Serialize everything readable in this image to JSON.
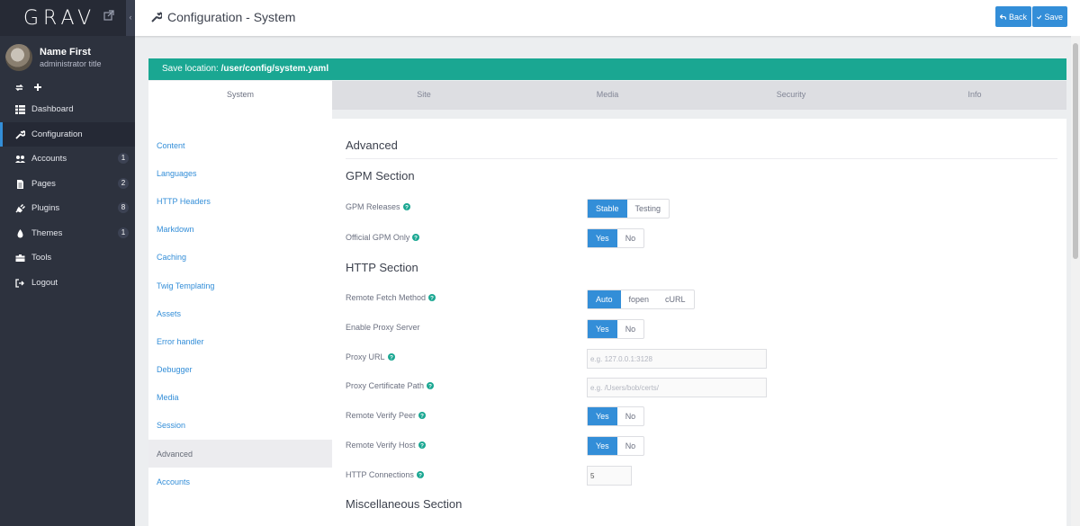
{
  "app": {
    "logo_text": "GRAV",
    "collapse_glyph": "‹"
  },
  "user": {
    "name": "Name First",
    "title": "administrator title"
  },
  "nav": {
    "items": [
      {
        "label": "Dashboard",
        "icon": "dashboard-icon",
        "badge": ""
      },
      {
        "label": "Configuration",
        "icon": "wrench-icon",
        "badge": ""
      },
      {
        "label": "Accounts",
        "icon": "users-icon",
        "badge": "1"
      },
      {
        "label": "Pages",
        "icon": "file-icon",
        "badge": "2"
      },
      {
        "label": "Plugins",
        "icon": "plug-icon",
        "badge": "8"
      },
      {
        "label": "Themes",
        "icon": "tint-icon",
        "badge": "1"
      },
      {
        "label": "Tools",
        "icon": "briefcase-icon",
        "badge": ""
      },
      {
        "label": "Logout",
        "icon": "sign-out-icon",
        "badge": ""
      }
    ],
    "active": "Configuration"
  },
  "header": {
    "title": "Configuration - System",
    "back_label": "Back",
    "save_label": "Save"
  },
  "save_location": {
    "prefix": "Save location:",
    "path": "/user/config/system.yaml"
  },
  "tabs": [
    "System",
    "Site",
    "Media",
    "Security",
    "Info"
  ],
  "active_tab": "System",
  "subnav": {
    "items": [
      "Content",
      "Languages",
      "HTTP Headers",
      "Markdown",
      "Caching",
      "Twig Templating",
      "Assets",
      "Error handler",
      "Debugger",
      "Media",
      "Session",
      "Advanced",
      "Accounts"
    ],
    "active": "Advanced"
  },
  "content": {
    "title": "Advanced",
    "gpm": {
      "heading": "GPM Section",
      "releases": {
        "label": "GPM Releases",
        "options": [
          "Stable",
          "Testing"
        ],
        "selected": "Stable"
      },
      "official_only": {
        "label": "Official GPM Only",
        "options": [
          "Yes",
          "No"
        ],
        "selected": "Yes"
      }
    },
    "http": {
      "heading": "HTTP Section",
      "fetch_method": {
        "label": "Remote Fetch Method",
        "options": [
          "Auto",
          "fopen",
          "cURL"
        ],
        "selected": "Auto"
      },
      "proxy": {
        "label": "Enable Proxy Server",
        "options": [
          "Yes",
          "No"
        ],
        "selected": "Yes"
      },
      "proxy_url": {
        "label": "Proxy URL",
        "placeholder": "e.g. 127.0.0.1:3128",
        "value": ""
      },
      "proxy_cert": {
        "label": "Proxy Certificate Path",
        "placeholder": "e.g. /Users/bob/certs/",
        "value": ""
      },
      "verify_peer": {
        "label": "Remote Verify Peer",
        "options": [
          "Yes",
          "No"
        ],
        "selected": "Yes"
      },
      "verify_host": {
        "label": "Remote Verify Host",
        "options": [
          "Yes",
          "No"
        ],
        "selected": "Yes"
      },
      "connections": {
        "label": "HTTP Connections",
        "value": "5"
      }
    },
    "misc": {
      "heading": "Miscellaneous Section"
    }
  },
  "colors": {
    "sidebar": "#2d323e",
    "accent_blue": "#338ed8",
    "save_location_teal": "#1aa792",
    "tab_bar": "#dddee2"
  }
}
